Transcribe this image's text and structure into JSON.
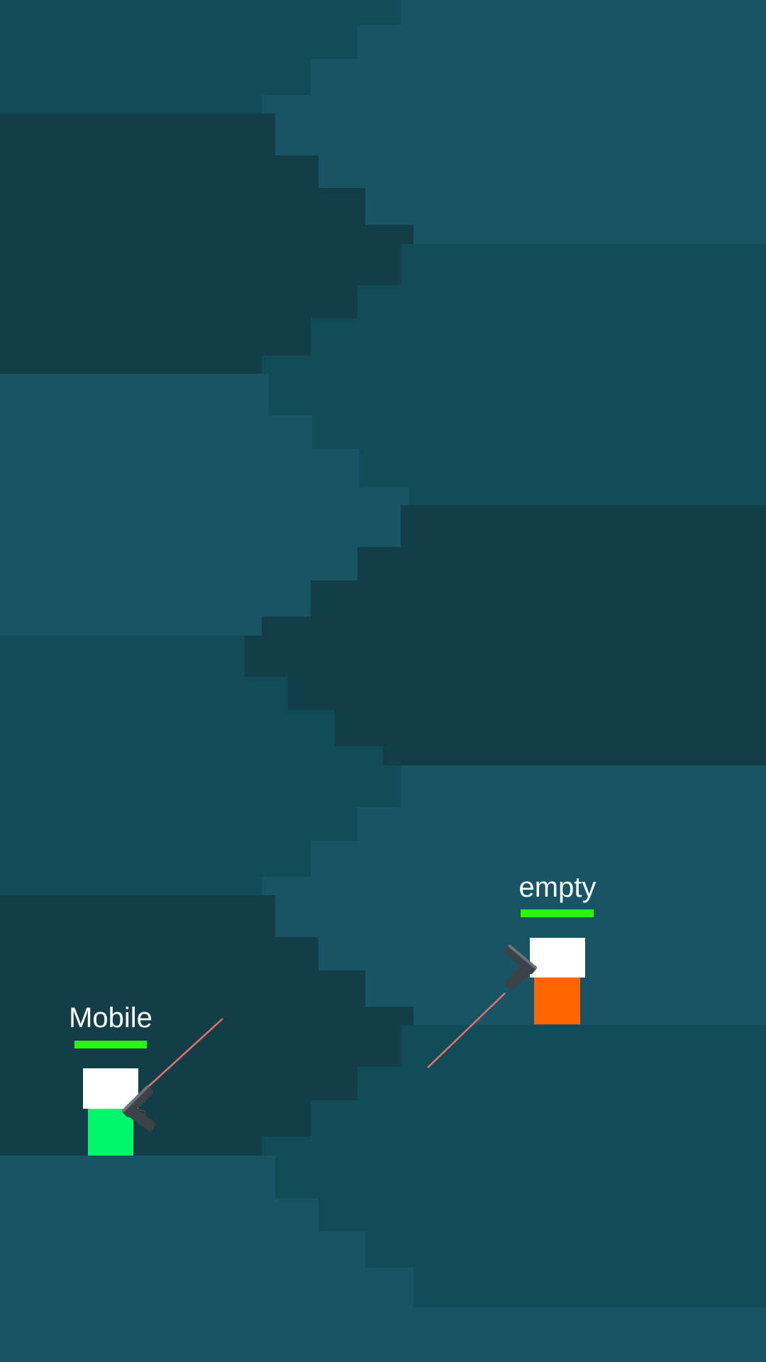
{
  "colors": {
    "teal_light": "#175464",
    "teal_mid": "#124b58",
    "teal_dark": "#143e47",
    "laser": "#e8716a",
    "health": "#2bf50b",
    "gun_body": "#3c4348",
    "gun_highlight": "#6a737a"
  },
  "players": [
    {
      "id": "local",
      "name": "Mobile",
      "health_fraction": 1.0,
      "body_color": "#00f56b",
      "facing": "right",
      "aim": "up-right",
      "laser_visible": true
    },
    {
      "id": "opponent",
      "name": "empty",
      "health_fraction": 1.0,
      "body_color": "#ff6600",
      "facing": "left",
      "aim": "down-left",
      "laser_visible": true
    }
  ]
}
